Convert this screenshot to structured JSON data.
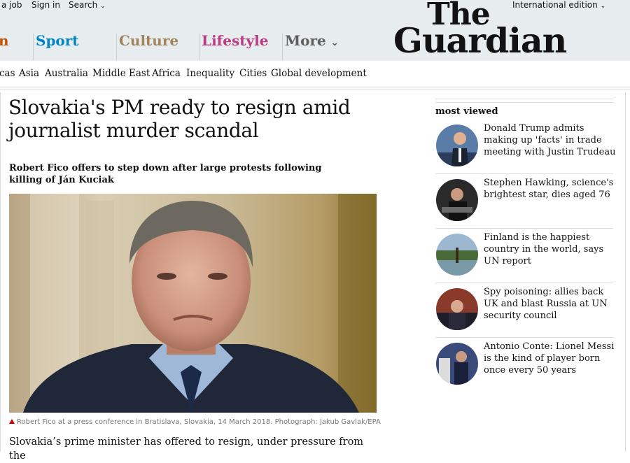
{
  "topbar": {
    "job_link": "a job",
    "signin": "Sign in",
    "search": "Search",
    "edition": "International edition"
  },
  "logo": {
    "line1": "The",
    "line2": "Guardian"
  },
  "pillars": [
    {
      "label": "n",
      "color": "#c05303"
    },
    {
      "label": "Sport",
      "color": "#0084c6"
    },
    {
      "label": "Culture",
      "color": "#a1845c"
    },
    {
      "label": "Lifestyle",
      "color": "#bb3b80"
    },
    {
      "label": "More",
      "color": "#5d5f5f"
    }
  ],
  "subnav": [
    "cas",
    "Asia",
    "Australia",
    "Middle East",
    "Africa",
    "Inequality",
    "Cities",
    "Global development"
  ],
  "article": {
    "headline": "Slovakia's PM ready to resign amid journalist murder scandal",
    "standfirst": "Robert Fico offers to step down after large protests following killing of Ján Kuciak",
    "caption": "Robert Fico at a press conference in Bratislava, Slovakia, 14 March 2018. Photograph: Jakub Gavlak/EPA",
    "body": "Slovakia’s prime minister has offered to resign, under pressure from the"
  },
  "most_viewed": {
    "title": "most viewed",
    "items": [
      {
        "text": "Donald Trump admits making up 'facts' in trade meeting with Justin Trudeau"
      },
      {
        "text": "Stephen Hawking, science's brightest star, dies aged 76"
      },
      {
        "text": "Finland is the happiest country in the world, says UN report"
      },
      {
        "text": "Spy poisoning: allies back UK and blast Russia at UN security council"
      },
      {
        "text": "Antonio Conte: Lionel Messi is the kind of player born once every 50 years"
      }
    ]
  }
}
